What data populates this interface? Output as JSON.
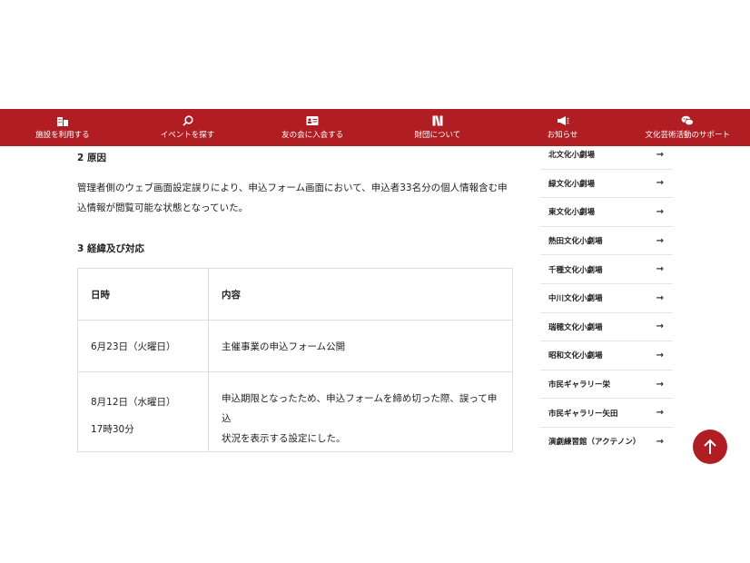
{
  "nav": {
    "items": [
      {
        "label": "施設を利用する",
        "icon": "building-icon"
      },
      {
        "label": "イベントを探す",
        "icon": "search-icon"
      },
      {
        "label": "友の会に入会する",
        "icon": "member-card-icon"
      },
      {
        "label": "財団について",
        "icon": "foundation-logo-icon"
      },
      {
        "label": "お知らせ",
        "icon": "megaphone-icon"
      },
      {
        "label": "文化芸術活動のサポート",
        "icon": "speech-bubbles-icon"
      }
    ]
  },
  "main": {
    "section2": {
      "heading": "2 原因",
      "body_line1": "管理者側のウェブ画面設定誤りにより、申込フォーム画面において、申込者33名分の個人情報含む申",
      "body_line2": "込情報が閲覧可能な状態となっていた。"
    },
    "section3": {
      "heading": "3 経緯及び対応",
      "table": {
        "headers": [
          "日時",
          "内容"
        ],
        "rows": [
          {
            "date": "6月23日（火曜日）",
            "content": "主催事業の申込フォーム公開"
          },
          {
            "date": "8月12日（水曜日）",
            "time": "17時30分",
            "content_line1": "申込期限となったため、申込フォームを締め切った際、誤って申込",
            "content_line2": "状況を表示する設定にした。"
          }
        ]
      }
    }
  },
  "sidebar": {
    "items": [
      {
        "label": "北文化小劇場"
      },
      {
        "label": "緑文化小劇場"
      },
      {
        "label": "東文化小劇場"
      },
      {
        "label": "熱田文化小劇場"
      },
      {
        "label": "千種文化小劇場"
      },
      {
        "label": "中川文化小劇場"
      },
      {
        "label": "瑞穂文化小劇場"
      },
      {
        "label": "昭和文化小劇場"
      },
      {
        "label": "市民ギャラリー栄"
      },
      {
        "label": "市民ギャラリー矢田"
      },
      {
        "label": "演劇練習館（アクテノン）"
      }
    ],
    "arrow": "→"
  },
  "colors": {
    "brand": "#b01e23"
  }
}
